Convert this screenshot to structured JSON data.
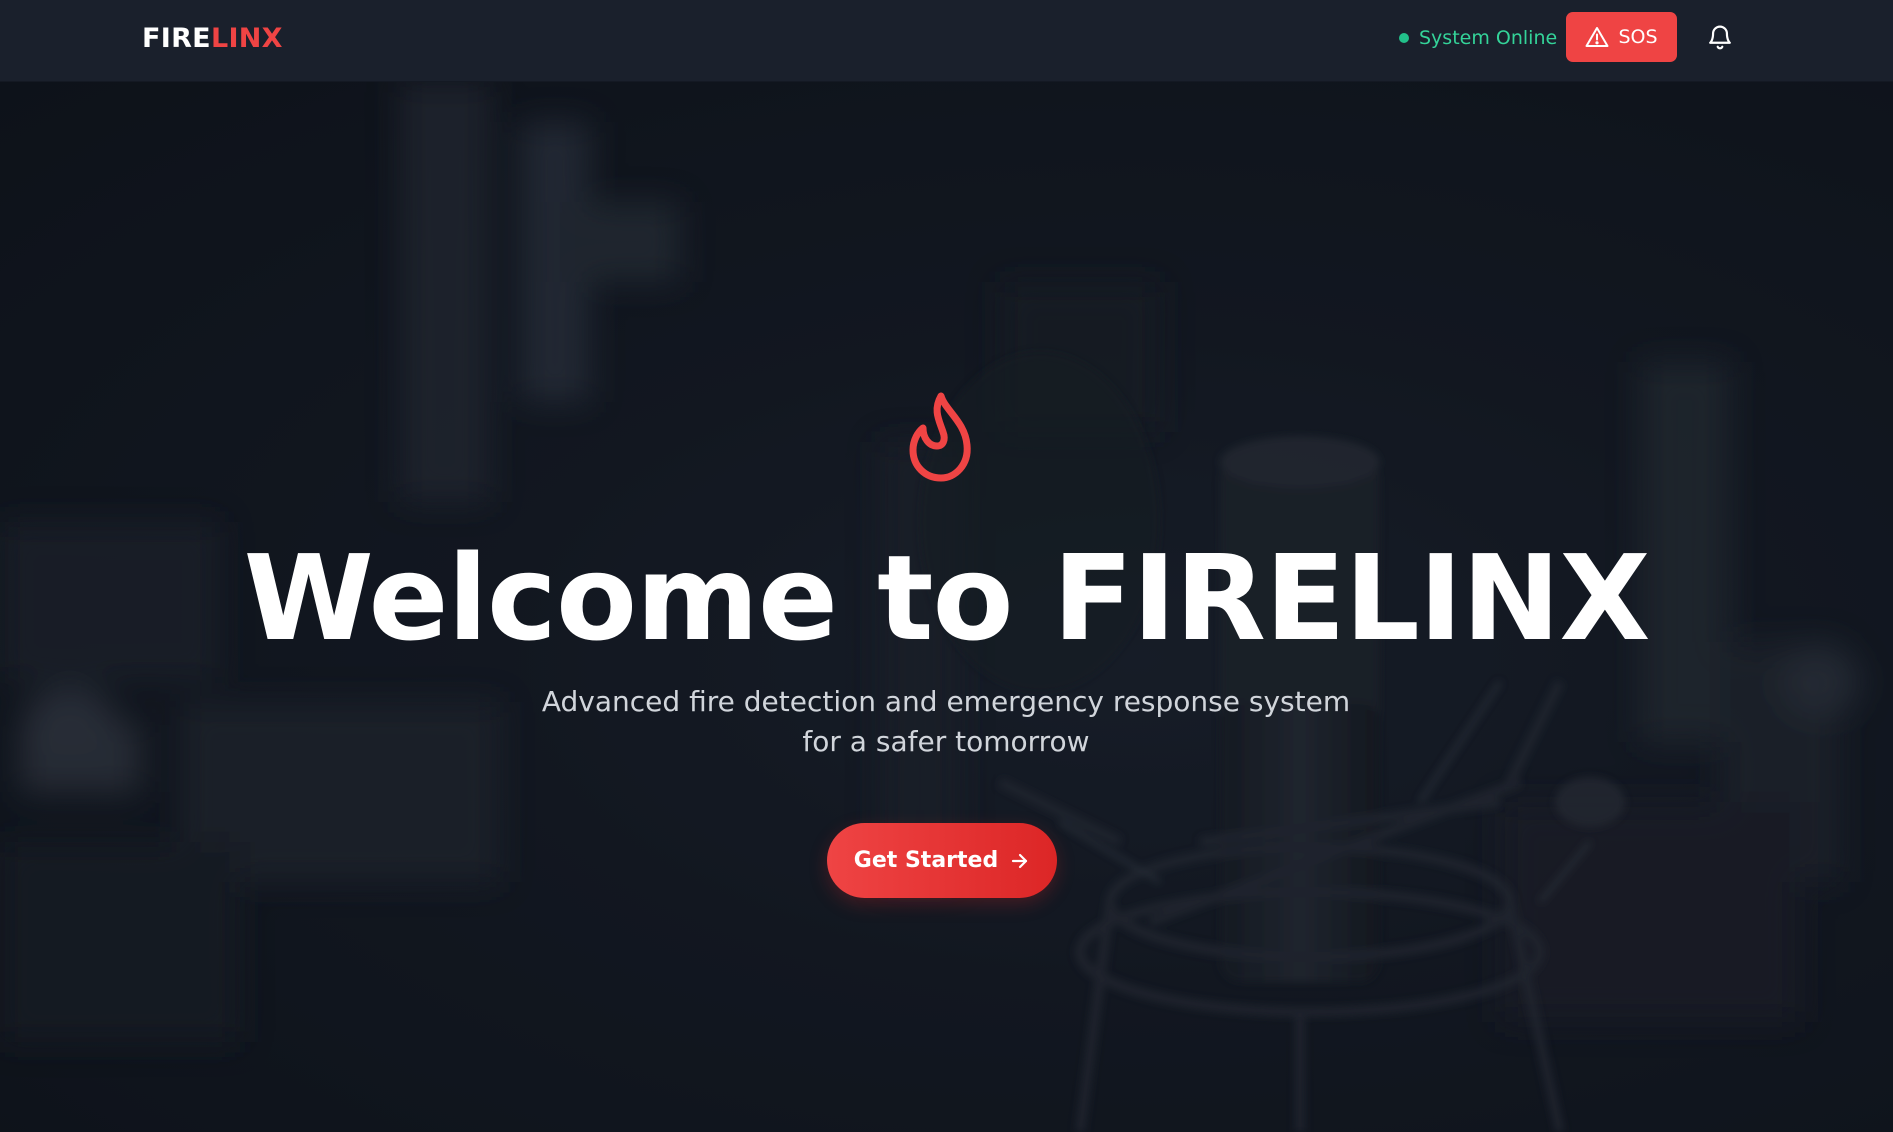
{
  "header": {
    "logo_part1": "FIRE",
    "logo_part2": "LINX",
    "status_text": "System Online",
    "sos_label": "SOS",
    "icons": {
      "status": "status-dot",
      "sos": "warning-triangle-icon",
      "notifications": "bell-icon"
    }
  },
  "hero": {
    "icon": "flame-icon",
    "title": "Welcome to FIRELINX",
    "subtitle": "Advanced fire detection and emergency response system for a safer tomorrow",
    "cta_label": "Get Started",
    "cta_icon": "arrow-right-icon"
  },
  "colors": {
    "accent": "#ef4444",
    "status_green": "#34d399",
    "navbar_bg": "#1a202c",
    "hero_bg": "#161b26"
  }
}
